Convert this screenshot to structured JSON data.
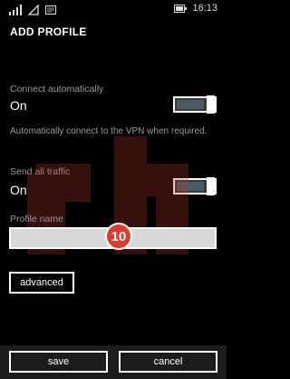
{
  "status_bar": {
    "time": "16:13"
  },
  "page": {
    "title": "ADD PROFILE"
  },
  "connect_automatically": {
    "label": "Connect automatically",
    "value": "On",
    "description": "Automatically connect to the VPN when required."
  },
  "send_all_traffic": {
    "label": "Send all traffic",
    "value": "On"
  },
  "profile_name": {
    "label": "Profile name",
    "value": "",
    "badge": "10"
  },
  "advanced": {
    "label": "advanced"
  },
  "appbar": {
    "save_label": "save",
    "cancel_label": "cancel"
  },
  "colors": {
    "accent": "#4a5a66",
    "badge": "#e03a2a",
    "input_bg": "#d8d8d8"
  }
}
